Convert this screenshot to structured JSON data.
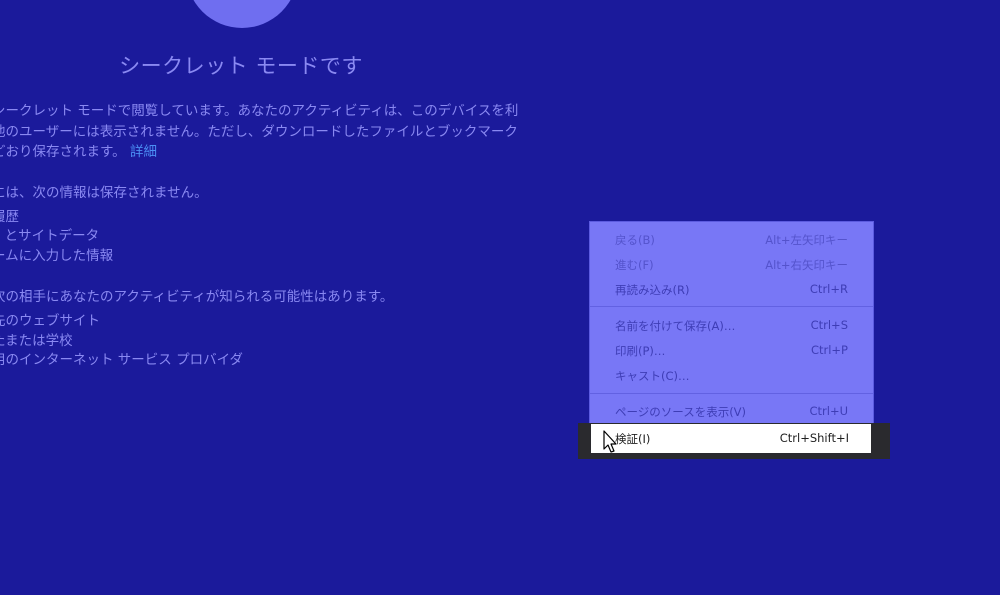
{
  "incognito": {
    "title": "シークレット モードです",
    "intro_lines": [
      "シークレット モードで閲覧しています。あなたのアクティビティは、このデバイスを利",
      "他のユーザーには表示されません。ただし、ダウンロードしたファイルとブックマーク",
      "どおり保存されます。"
    ],
    "intro_link": "詳細",
    "not_saved_heading": "には、次の情報は保存されません。",
    "not_saved_items": [
      "履歴",
      "e とサイトデータ",
      "ームに入力した情報"
    ],
    "visible_heading": "次の相手にあなたのアクティビティが知られる可能性はあります。",
    "visible_items": [
      "先のウェブサイト",
      "たまたは学校",
      "用のインターネット サービス プロバイダ"
    ]
  },
  "context_menu": {
    "items": [
      {
        "label": "戻る(B)",
        "shortcut": "Alt+左矢印キー",
        "disabled": true
      },
      {
        "label": "進む(F)",
        "shortcut": "Alt+右矢印キー",
        "disabled": true
      },
      {
        "label": "再読み込み(R)",
        "shortcut": "Ctrl+R",
        "disabled": false
      },
      {
        "label": "名前を付けて保存(A)…",
        "shortcut": "Ctrl+S",
        "disabled": false
      },
      {
        "label": "印刷(P)…",
        "shortcut": "Ctrl+P",
        "disabled": false
      },
      {
        "label": "キャスト(C)…",
        "shortcut": "",
        "disabled": false
      },
      {
        "label": "ページのソースを表示(V)",
        "shortcut": "Ctrl+U",
        "disabled": false
      }
    ],
    "highlighted": {
      "label": "検証(I)",
      "shortcut": "Ctrl+Shift+I"
    }
  },
  "icons": {
    "avatar": "incognito-avatar-icon",
    "cursor": "arrow-cursor-icon"
  },
  "colors": {
    "background": "#1b1a9b",
    "text": "#8a89f2",
    "link": "#4b8ff5",
    "menu": "#7877f6",
    "highlight": "#ffffff"
  }
}
